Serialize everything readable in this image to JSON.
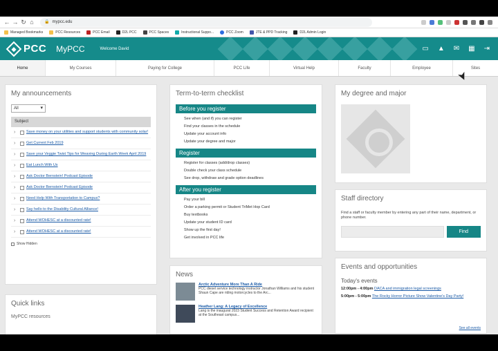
{
  "browser": {
    "url": "mypcc.edu",
    "bookmarks": [
      "Managed Bookmarks",
      "PCC Resources",
      "PCC Email",
      "D2L PCC",
      "PCC Spaces",
      "Instructional Suppo...",
      "PCC Zoom",
      "JTE & PPD Tracking",
      "D2L Admin Login"
    ]
  },
  "header": {
    "logo_text": "PCC",
    "brand": "MyPCC",
    "welcome": "Welcome David"
  },
  "tabs": [
    "Home",
    "My Courses",
    "Paying for College",
    "PCC Life",
    "Virtual Help",
    "Faculty",
    "Employee",
    "Sites"
  ],
  "announcements": {
    "title": "My announcements",
    "filter": "All",
    "subject_header": "Subject",
    "items": [
      "Save money on your utilities and support students with community solar!",
      "Get Current Feb 2019",
      "Save your Veggie Twist Tips for Weaving During Earth Week April 2019",
      "Eat Lunch With Us",
      "Ask Doctor Bernstein! Podcast Episode",
      "Ask Doctor Bernstein! Podcast Episode",
      "Need Help With Transportation to Campus?",
      "Say hello to the Disability Cultural Alliance!",
      "Attend WOHESC at a discounted rate!",
      "Attend WOHESC at a discounted rate!"
    ],
    "show_hidden": "Show Hidden"
  },
  "quick_links": {
    "title": "Quick links",
    "subtitle": "MyPCC resources"
  },
  "checklist": {
    "title": "Term-to-term checklist",
    "sections": [
      {
        "heading": "Before you register",
        "items": [
          "See when (and if) you can register",
          "Find your classes in the schedule",
          "Update your account info",
          "Update your degree and major"
        ]
      },
      {
        "heading": "Register",
        "items": [
          "Register for classes (add/drop classes)",
          "Double check your class schedule",
          "See drop, withdraw and grade option deadlines"
        ]
      },
      {
        "heading": "After you register",
        "items": [
          "Pay your bill",
          "Order a parking permit or Student TriMet Hop Card",
          "Buy textbooks",
          "Update your student ID card",
          "Show up the first day!",
          "Get involved in PCC life"
        ]
      }
    ]
  },
  "news": {
    "title": "News",
    "items": [
      {
        "title": "Arctic Adventure More Than A Ride",
        "body": "PCC diesel service technology instructor Jonathan Williams and his student Shaun Cape are riding motorcycles to the Arc..."
      },
      {
        "title": "Heather Lang: A Legacy of Excellence",
        "body": "Lang is the inaugural 2023 Student Success and Retention Award recipient at the Southeast campus..."
      }
    ]
  },
  "degree": {
    "title": "My degree and major"
  },
  "staff": {
    "title": "Staff directory",
    "description": "Find a staff or faculty member by entering any part of their name, department, or phone number.",
    "find_label": "Find"
  },
  "events": {
    "title": "Events and opportunities",
    "today_label": "Today's events",
    "items": [
      {
        "time": "12:00pm - 4:00pm",
        "title": "DACA and immigration legal screenings"
      },
      {
        "time": "5:00pm - 5:00pm",
        "title": "The Rocky Horror Picture Show Valentine's Day Party!"
      }
    ],
    "see_all": "See all events"
  },
  "colors": {
    "brand_teal": "#158b8b",
    "section_teal": "#168686",
    "link_blue": "#1a5aa6"
  }
}
